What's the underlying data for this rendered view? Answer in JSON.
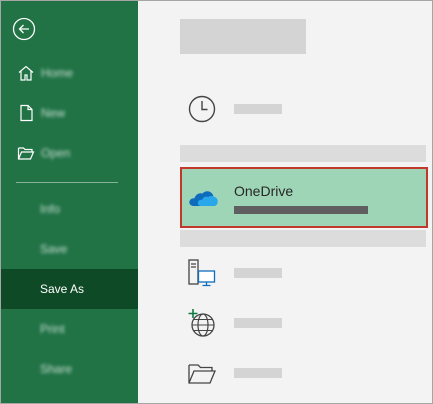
{
  "sidebar": {
    "back_icon": "back-arrow-icon",
    "items": [
      {
        "label": "Home",
        "icon": "home-icon"
      },
      {
        "label": "New",
        "icon": "new-document-icon"
      },
      {
        "label": "Open",
        "icon": "folder-open-icon"
      },
      {
        "label": "Info"
      },
      {
        "label": "Save"
      },
      {
        "label": "Save As",
        "active": true
      },
      {
        "label": "Print"
      },
      {
        "label": "Share"
      }
    ]
  },
  "main": {
    "locations": {
      "recent": {
        "icon": "clock-icon"
      },
      "onedrive": {
        "label": "OneDrive",
        "icon": "onedrive-cloud-icon",
        "selected": true
      },
      "this_pc": {
        "icon": "this-pc-icon"
      },
      "add_place": {
        "icon": "add-place-globe-icon"
      },
      "browse": {
        "icon": "folder-browse-icon"
      }
    }
  },
  "colors": {
    "sidebar": "#217346",
    "sidebar_active": "#0f4a26",
    "selected_bg": "#9fd5b7",
    "selected_border": "#c0392b"
  }
}
